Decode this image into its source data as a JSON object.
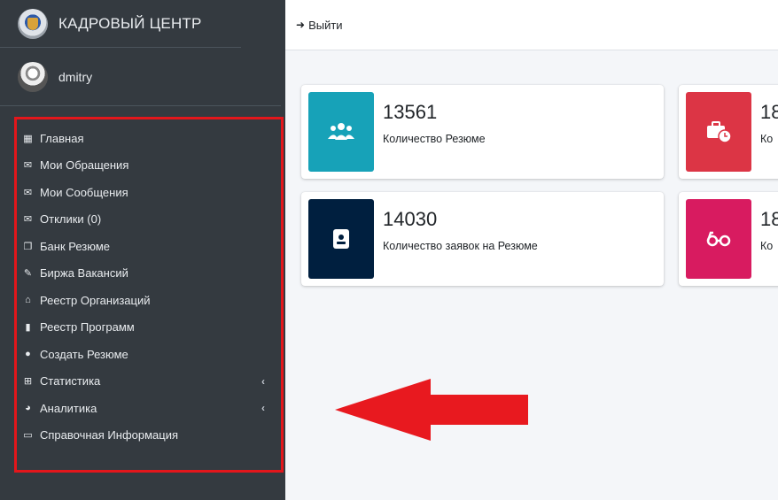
{
  "sidebar": {
    "brand_title": "КАДРОВЫЙ ЦЕНТР",
    "user_name": "dmitry",
    "items": [
      {
        "label": "Главная",
        "icon": "th-icon",
        "glyph": "▦"
      },
      {
        "label": "Мои Обращения",
        "icon": "envelope-icon",
        "glyph": "✉"
      },
      {
        "label": "Мои Сообщения",
        "icon": "envelope-icon",
        "glyph": "✉"
      },
      {
        "label": "Отклики (0)",
        "icon": "envelope-icon",
        "glyph": "✉"
      },
      {
        "label": "Банк Резюме",
        "icon": "copy-icon",
        "glyph": "❐"
      },
      {
        "label": "Биржа Вакансий",
        "icon": "edit-icon",
        "glyph": "✎"
      },
      {
        "label": "Реестр Организаций",
        "icon": "university-icon",
        "glyph": "⌂"
      },
      {
        "label": "Реестр Программ",
        "icon": "bookmark-icon",
        "glyph": "▮"
      },
      {
        "label": "Создать Резюме",
        "icon": "circle-icon",
        "glyph": "●"
      },
      {
        "label": "Статистика",
        "icon": "plus-square-icon",
        "glyph": "⊞",
        "chevron": "‹"
      },
      {
        "label": "Аналитика",
        "icon": "pie-chart-icon",
        "glyph": "◕",
        "chevron": "‹"
      },
      {
        "label": "Справочная Информация",
        "icon": "folder-icon",
        "glyph": "▭"
      }
    ]
  },
  "topbar": {
    "logout_label": "Выйти"
  },
  "info_boxes": [
    {
      "number": "13561",
      "text": "Количество Резюме",
      "color": "#17a2b8",
      "icon": "users-icon",
      "glyph": "👥"
    },
    {
      "number": "18",
      "text": "Ко",
      "color": "#dc3545",
      "icon": "business-time-icon",
      "glyph": "💼"
    },
    {
      "number": "14030",
      "text": "Количество заявок на Резюме",
      "color": "#001f3f",
      "icon": "id-card-icon",
      "glyph": "▣"
    },
    {
      "number": "18",
      "text": "Ко",
      "color": "#d81b60",
      "icon": "glasses-icon",
      "glyph": "ϭ"
    }
  ],
  "colors": {
    "sidebar_bg": "#343a40",
    "highlight_border": "#e3161b",
    "arrow": "#e8191f"
  }
}
